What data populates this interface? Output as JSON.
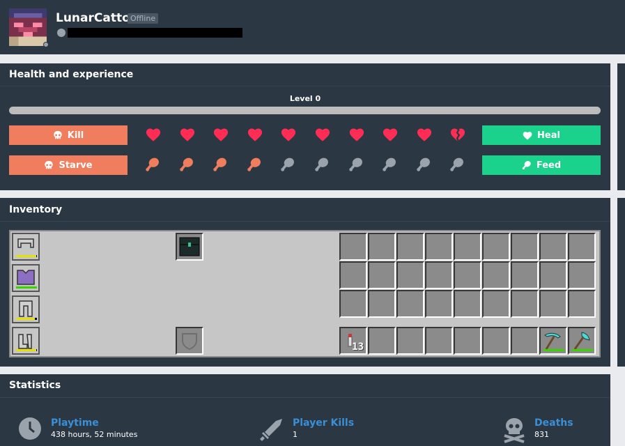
{
  "profile": {
    "username": "LunarCatto",
    "status": "Offline"
  },
  "health_panel": {
    "title": "Health and experience",
    "level_label": "Level 0",
    "xp_fraction": 0,
    "kill_label": "Kill",
    "heal_label": "Heal",
    "starve_label": "Starve",
    "feed_label": "Feed",
    "hearts": 9.5,
    "hearts_max": 10,
    "food": 3.5,
    "food_max": 10,
    "colors": {
      "red_button": "#ef7d5e",
      "green_button": "#1bd28d",
      "heart": "#ff2d55",
      "food": "#ef7d5e",
      "food_empty": "#9aa3ab"
    }
  },
  "inventory_panel": {
    "title": "Inventory",
    "armor": [
      {
        "name": "helmet-icon",
        "durability": 0.95,
        "dura_color": "#e5e100"
      },
      {
        "name": "chestplate-icon",
        "durability": 1,
        "dura_color": "#39d400"
      },
      {
        "name": "leggings-icon",
        "durability": 0.9,
        "dura_color": "#e5e100"
      },
      {
        "name": "boots-icon",
        "durability": 0.95,
        "dura_color": "#e5e100"
      }
    ],
    "offhand_item": "ender-chest-icon",
    "hotbar": [
      {
        "slot": 0,
        "item": "firework-rocket-icon",
        "count": "13"
      },
      {
        "slot": 7,
        "item": "diamond-pickaxe-icon",
        "durability": 1,
        "dura_color": "#39d400"
      },
      {
        "slot": 8,
        "item": "diamond-axe-icon",
        "durability": 1,
        "dura_color": "#39d400"
      }
    ]
  },
  "statistics_panel": {
    "title": "Statistics",
    "items": [
      {
        "icon": "clock-icon",
        "label": "Playtime",
        "value": "438 hours, 52 minutes"
      },
      {
        "icon": "sword-icon",
        "label": "Player Kills",
        "value": "1"
      },
      {
        "icon": "skull-icon",
        "label": "Deaths",
        "value": "831"
      }
    ]
  }
}
